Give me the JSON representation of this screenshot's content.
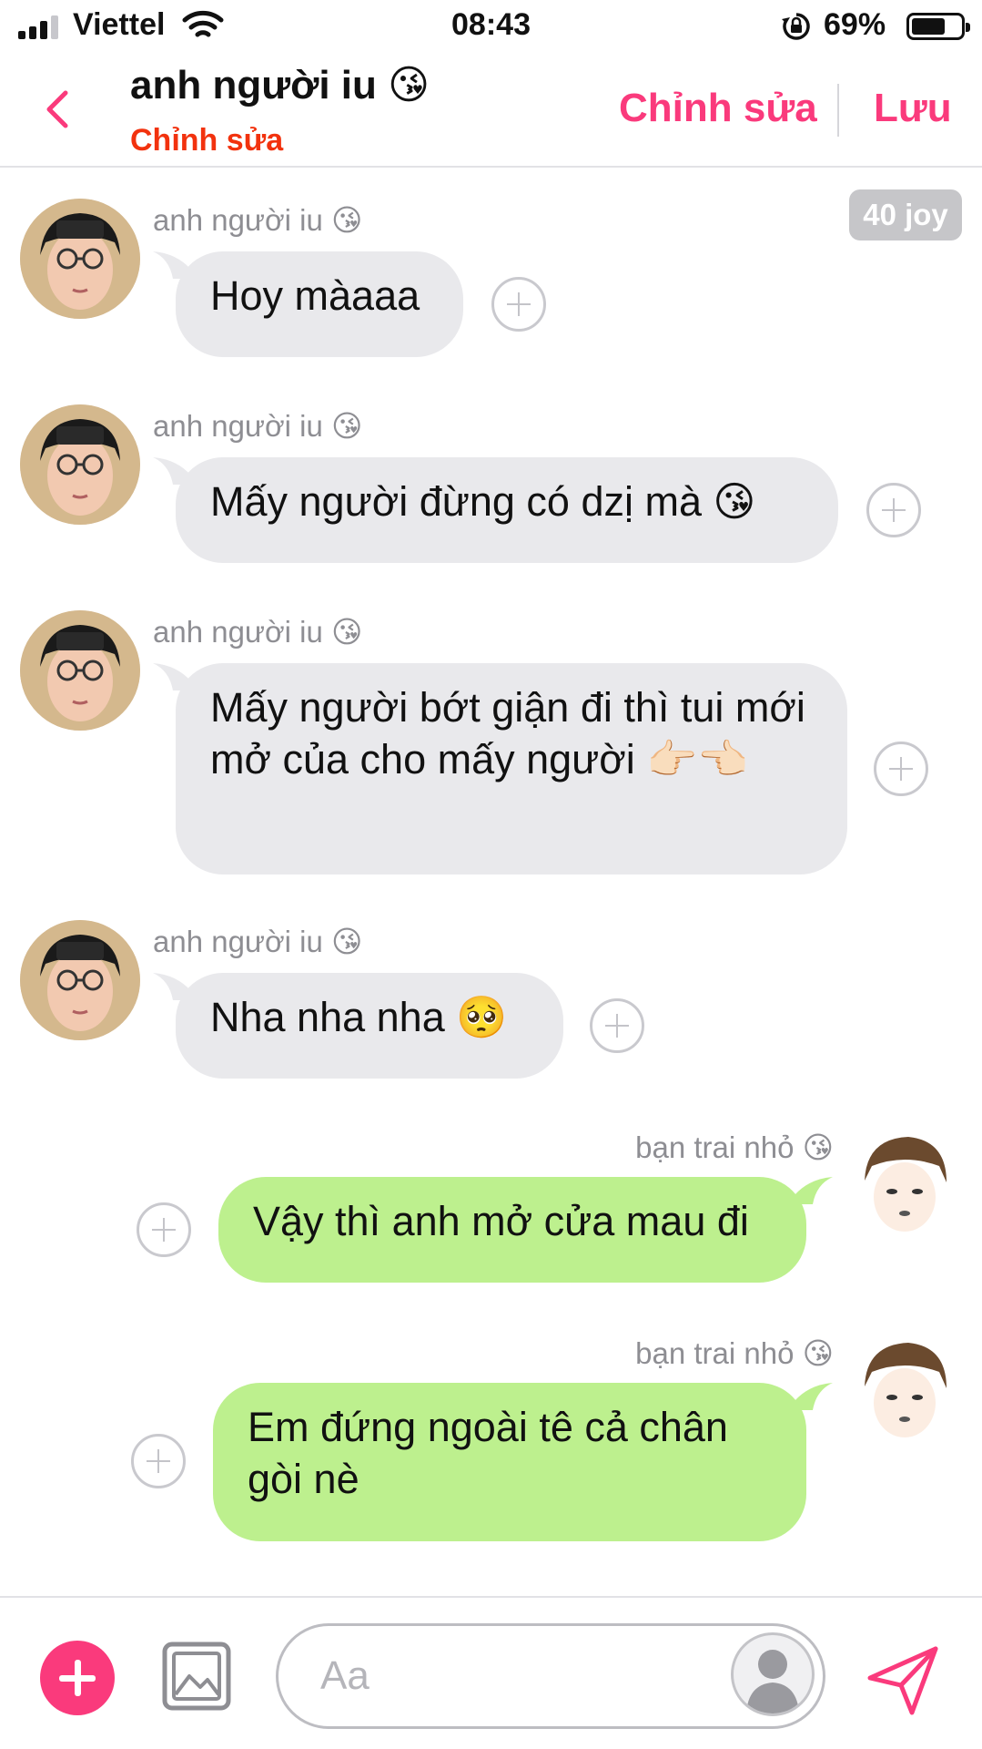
{
  "status_bar": {
    "carrier": "Viettel",
    "time": "08:43",
    "battery_percent": "69%",
    "battery_level": 0.69
  },
  "header": {
    "title": "anh người iu 😘",
    "subtitle": "Chỉnh sửa",
    "edit_label": "Chỉnh sửa",
    "save_label": "Lưu"
  },
  "joy_badge": "40 joy",
  "messages": [
    {
      "side": "incoming",
      "sender": "anh người iu 😘",
      "text": "Hoy màaaa"
    },
    {
      "side": "incoming",
      "sender": "anh người iu 😘",
      "text": "Mấy người đừng có dzị mà 😘"
    },
    {
      "side": "incoming",
      "sender": "anh người iu 😘",
      "text": "Mấy người bớt giận đi thì tui mới mở của cho mấy người 👉🏻👈🏻"
    },
    {
      "side": "incoming",
      "sender": "anh người iu 😘",
      "text": "Nha nha nha 🥺"
    },
    {
      "side": "outgoing",
      "sender": "bạn trai nhỏ 😘",
      "text": "Vậy thì anh mở cửa mau đi"
    },
    {
      "side": "outgoing",
      "sender": "bạn trai nhỏ 😘",
      "text": "Em đứng ngoài tê cả chân gòi nè"
    }
  ],
  "composer": {
    "placeholder": "Aa"
  },
  "colors": {
    "accent": "#fa3a7c",
    "subtitle_red": "#f2320e",
    "incoming_bubble": "#e9e9ec",
    "outgoing_bubble": "#bdf08e"
  },
  "icons": {
    "back": "chevron-left-icon",
    "add": "plus-icon",
    "image": "image-icon",
    "send": "send-icon",
    "reaction": "add-reaction-icon"
  }
}
